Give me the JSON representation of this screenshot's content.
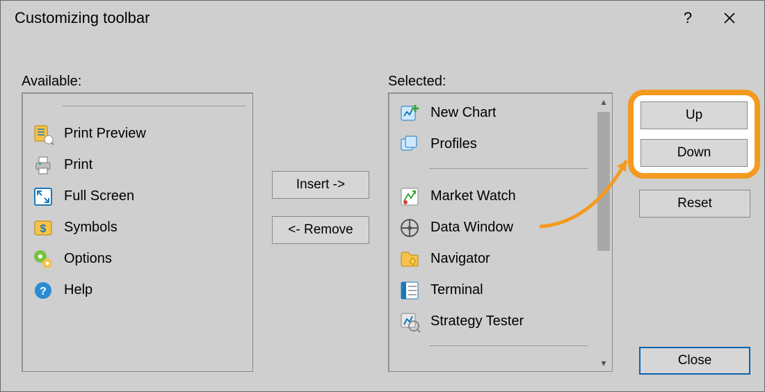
{
  "title": "Customizing toolbar",
  "labels": {
    "available": "Available:",
    "selected": "Selected:"
  },
  "buttons": {
    "insert": "Insert ->",
    "remove": "<- Remove",
    "up": "Up",
    "down": "Down",
    "reset": "Reset",
    "close": "Close",
    "help": "?"
  },
  "available_items": [
    {
      "label": "Print Preview",
      "icon": "print-preview"
    },
    {
      "label": "Print",
      "icon": "print"
    },
    {
      "label": "Full Screen",
      "icon": "fullscreen"
    },
    {
      "label": "Symbols",
      "icon": "symbols"
    },
    {
      "label": "Options",
      "icon": "options"
    },
    {
      "label": "Help",
      "icon": "help"
    }
  ],
  "selected_items": [
    {
      "label": "New Chart",
      "icon": "new-chart"
    },
    {
      "label": "Profiles",
      "icon": "profiles"
    },
    {
      "separator": true
    },
    {
      "label": "Market Watch",
      "icon": "market-watch"
    },
    {
      "label": "Data Window",
      "icon": "data-window"
    },
    {
      "label": "Navigator",
      "icon": "navigator"
    },
    {
      "label": "Terminal",
      "icon": "terminal"
    },
    {
      "label": "Strategy Tester",
      "icon": "strategy-tester"
    }
  ]
}
